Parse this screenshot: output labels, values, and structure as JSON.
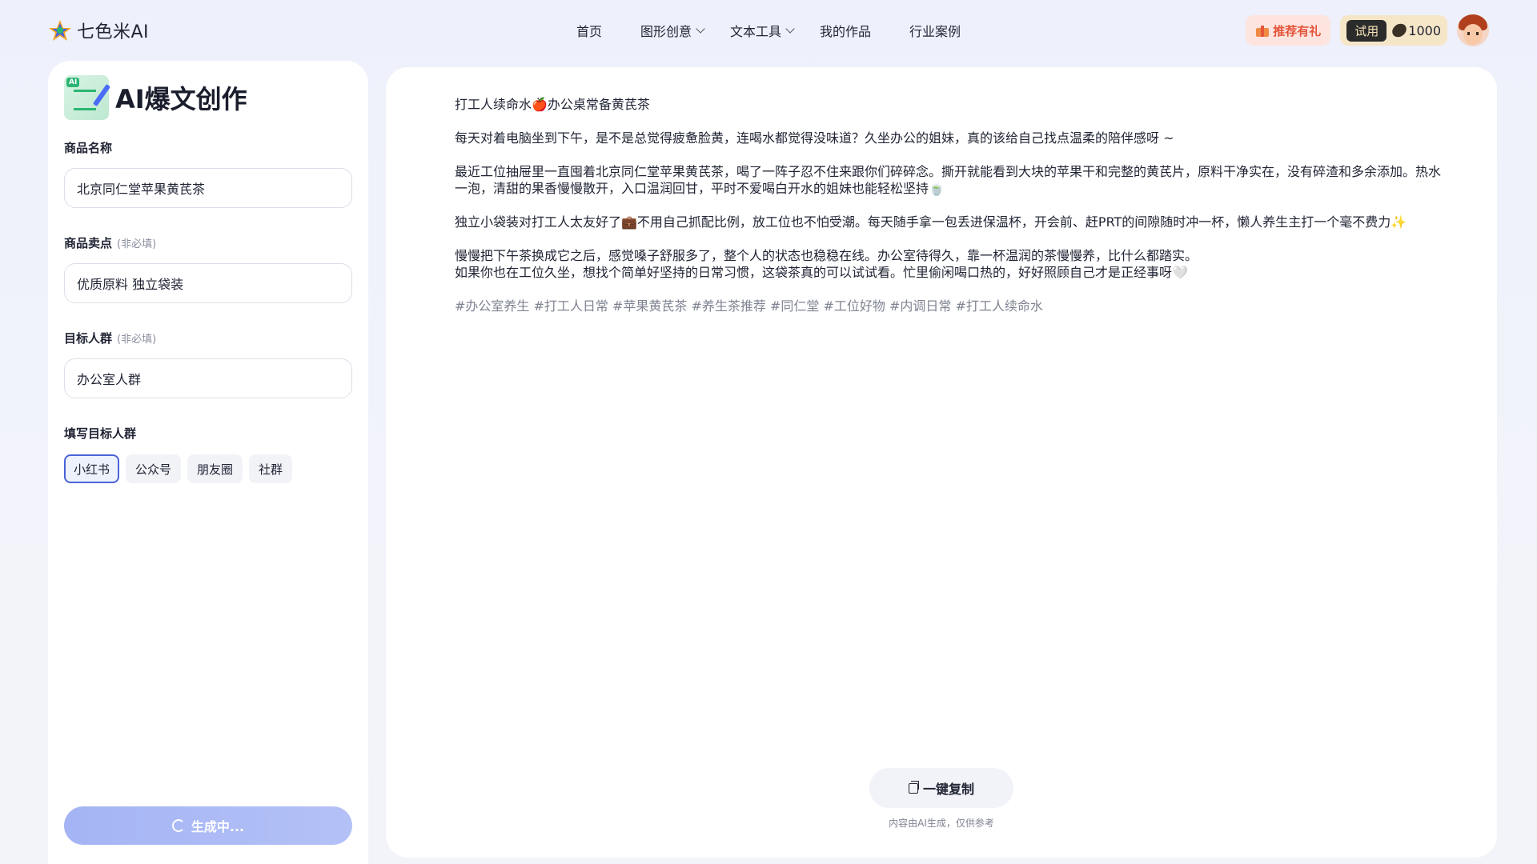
{
  "brand": {
    "name": "七色米AI"
  },
  "nav": {
    "items": [
      {
        "label": "首页",
        "has_dropdown": false
      },
      {
        "label": "图形创意",
        "has_dropdown": true
      },
      {
        "label": "文本工具",
        "has_dropdown": true
      },
      {
        "label": "我的作品",
        "has_dropdown": false
      },
      {
        "label": "行业案例",
        "has_dropdown": false
      }
    ]
  },
  "header_actions": {
    "referral_label": "推荐有礼",
    "trial_label": "试用",
    "credits": "1000"
  },
  "left_panel": {
    "title": "AI爆文创作",
    "icon_tag": "AI",
    "fields": {
      "product_name": {
        "label": "商品名称",
        "value": "北京同仁堂苹果黄芪茶"
      },
      "selling_points": {
        "label": "商品卖点",
        "optional": "(非必填)",
        "value": "优质原料 独立袋装"
      },
      "target_audience": {
        "label": "目标人群",
        "optional": "(非必填)",
        "value": "办公室人群"
      }
    },
    "platform_label": "填写目标人群",
    "platforms": [
      "小红书",
      "公众号",
      "朋友圈",
      "社群"
    ],
    "selected_platform": "小红书",
    "generate_label": "生成中..."
  },
  "article": {
    "title": "打工人续命水🍎办公桌常备黄芪茶",
    "paragraphs": [
      "每天对着电脑坐到下午，是不是总觉得疲惫脸黄，连喝水都觉得没味道？久坐办公的姐妹，真的该给自己找点温柔的陪伴感呀 ~",
      "最近工位抽屉里一直囤着北京同仁堂苹果黄芪茶，喝了一阵子忍不住来跟你们碎碎念。撕开就能看到大块的苹果干和完整的黄芪片，原料干净实在，没有碎渣和多余添加。热水一泡，清甜的果香慢慢散开，入口温润回甘，平时不爱喝白开水的姐妹也能轻松坚持🍵",
      "独立小袋装对打工人太友好了💼不用自己抓配比例，放工位也不怕受潮。每天随手拿一包丢进保温杯，开会前、赶PRT的间隙随时冲一杯，懒人养生主打一个毫不费力✨",
      "慢慢把下午茶换成它之后，感觉嗓子舒服多了，整个人的状态也稳稳在线。办公室待得久，靠一杯温润的茶慢慢养，比什么都踏实。\n如果你也在工位久坐，想找个简单好坚持的日常习惯，这袋茶真的可以试试看。忙里偷闲喝口热的，好好照顾自己才是正经事呀🤍"
    ],
    "tags": "#办公室养生 #打工人日常 #苹果黄芪茶 #养生茶推荐 #同仁堂 #工位好物 #内调日常 #打工人续命水"
  },
  "footer": {
    "copy_label": "一键复制",
    "disclaimer": "内容由AI生成，仅供参考"
  },
  "colors": {
    "accent": "#4a63d8",
    "generate_button": "#a4b4f4",
    "referral_text": "#e4553a",
    "credits_bg": "#f6e6c8"
  }
}
